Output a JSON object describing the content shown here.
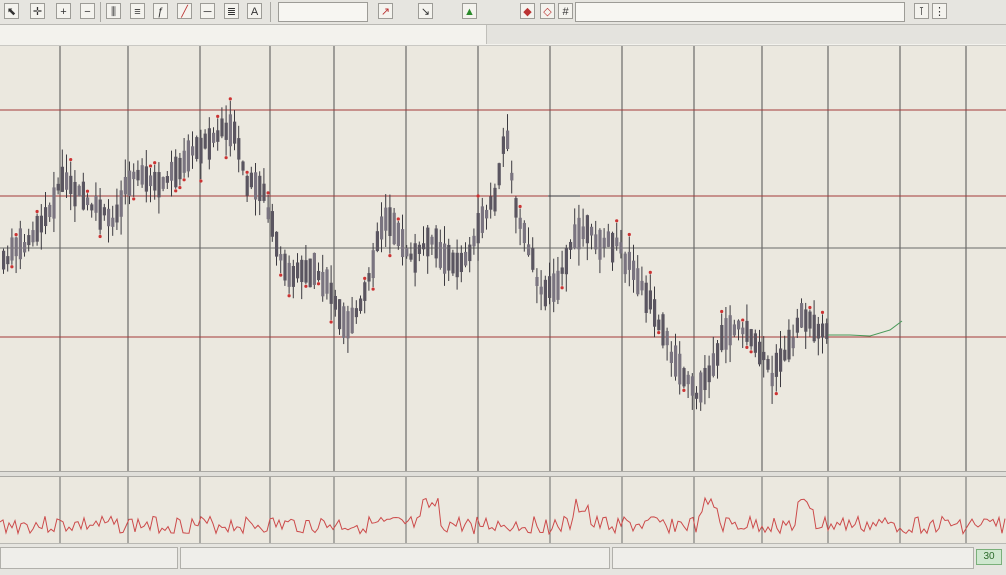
{
  "toolbar": {
    "buttons": [
      {
        "icon": "cursor-icon"
      },
      {
        "icon": "crosshair-icon"
      },
      {
        "icon": "zoom-in-icon"
      },
      {
        "icon": "zoom-out-icon"
      },
      {
        "icon": "chart-type-icon"
      },
      {
        "icon": "template-icon"
      },
      {
        "icon": "indicator-icon"
      },
      {
        "icon": "line-tool-icon"
      },
      {
        "icon": "hline-icon"
      },
      {
        "icon": "fib-icon"
      },
      {
        "icon": "text-tool-icon"
      },
      {
        "icon": "arrow-up-icon"
      },
      {
        "icon": "arrow-down-icon"
      },
      {
        "icon": "period-icon"
      },
      {
        "icon": "buy-icon"
      },
      {
        "icon": "sell-icon"
      },
      {
        "icon": "grid-icon"
      }
    ]
  },
  "infobar": {
    "line1": "",
    "line2": "",
    "marker": ""
  },
  "status": {
    "left": "",
    "badge": "30"
  },
  "colors": {
    "background": "#ecebe6",
    "grid": "#6a6a68",
    "level_line": "#a33a3a",
    "candle": "#5a5560",
    "oscillator": "#cc4a4a",
    "accent_green": "#2a8a2a"
  }
}
